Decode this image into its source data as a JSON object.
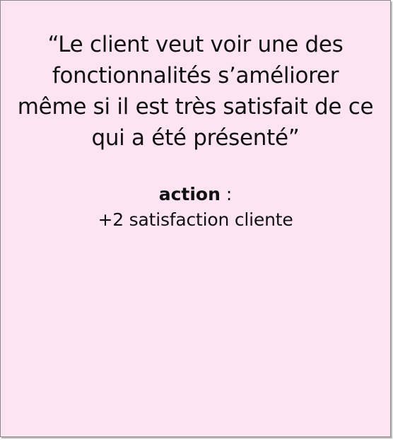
{
  "card": {
    "background_color": "#fde4f2",
    "border_color": "#8a8a8a",
    "quote": "“Le client veut voir une des fonctionnalités s’améliorer même si il est très satisfait de ce qui a été présenté”",
    "action": {
      "label": "action",
      "separator": " :",
      "effect": "+2 satisfaction cliente"
    }
  }
}
